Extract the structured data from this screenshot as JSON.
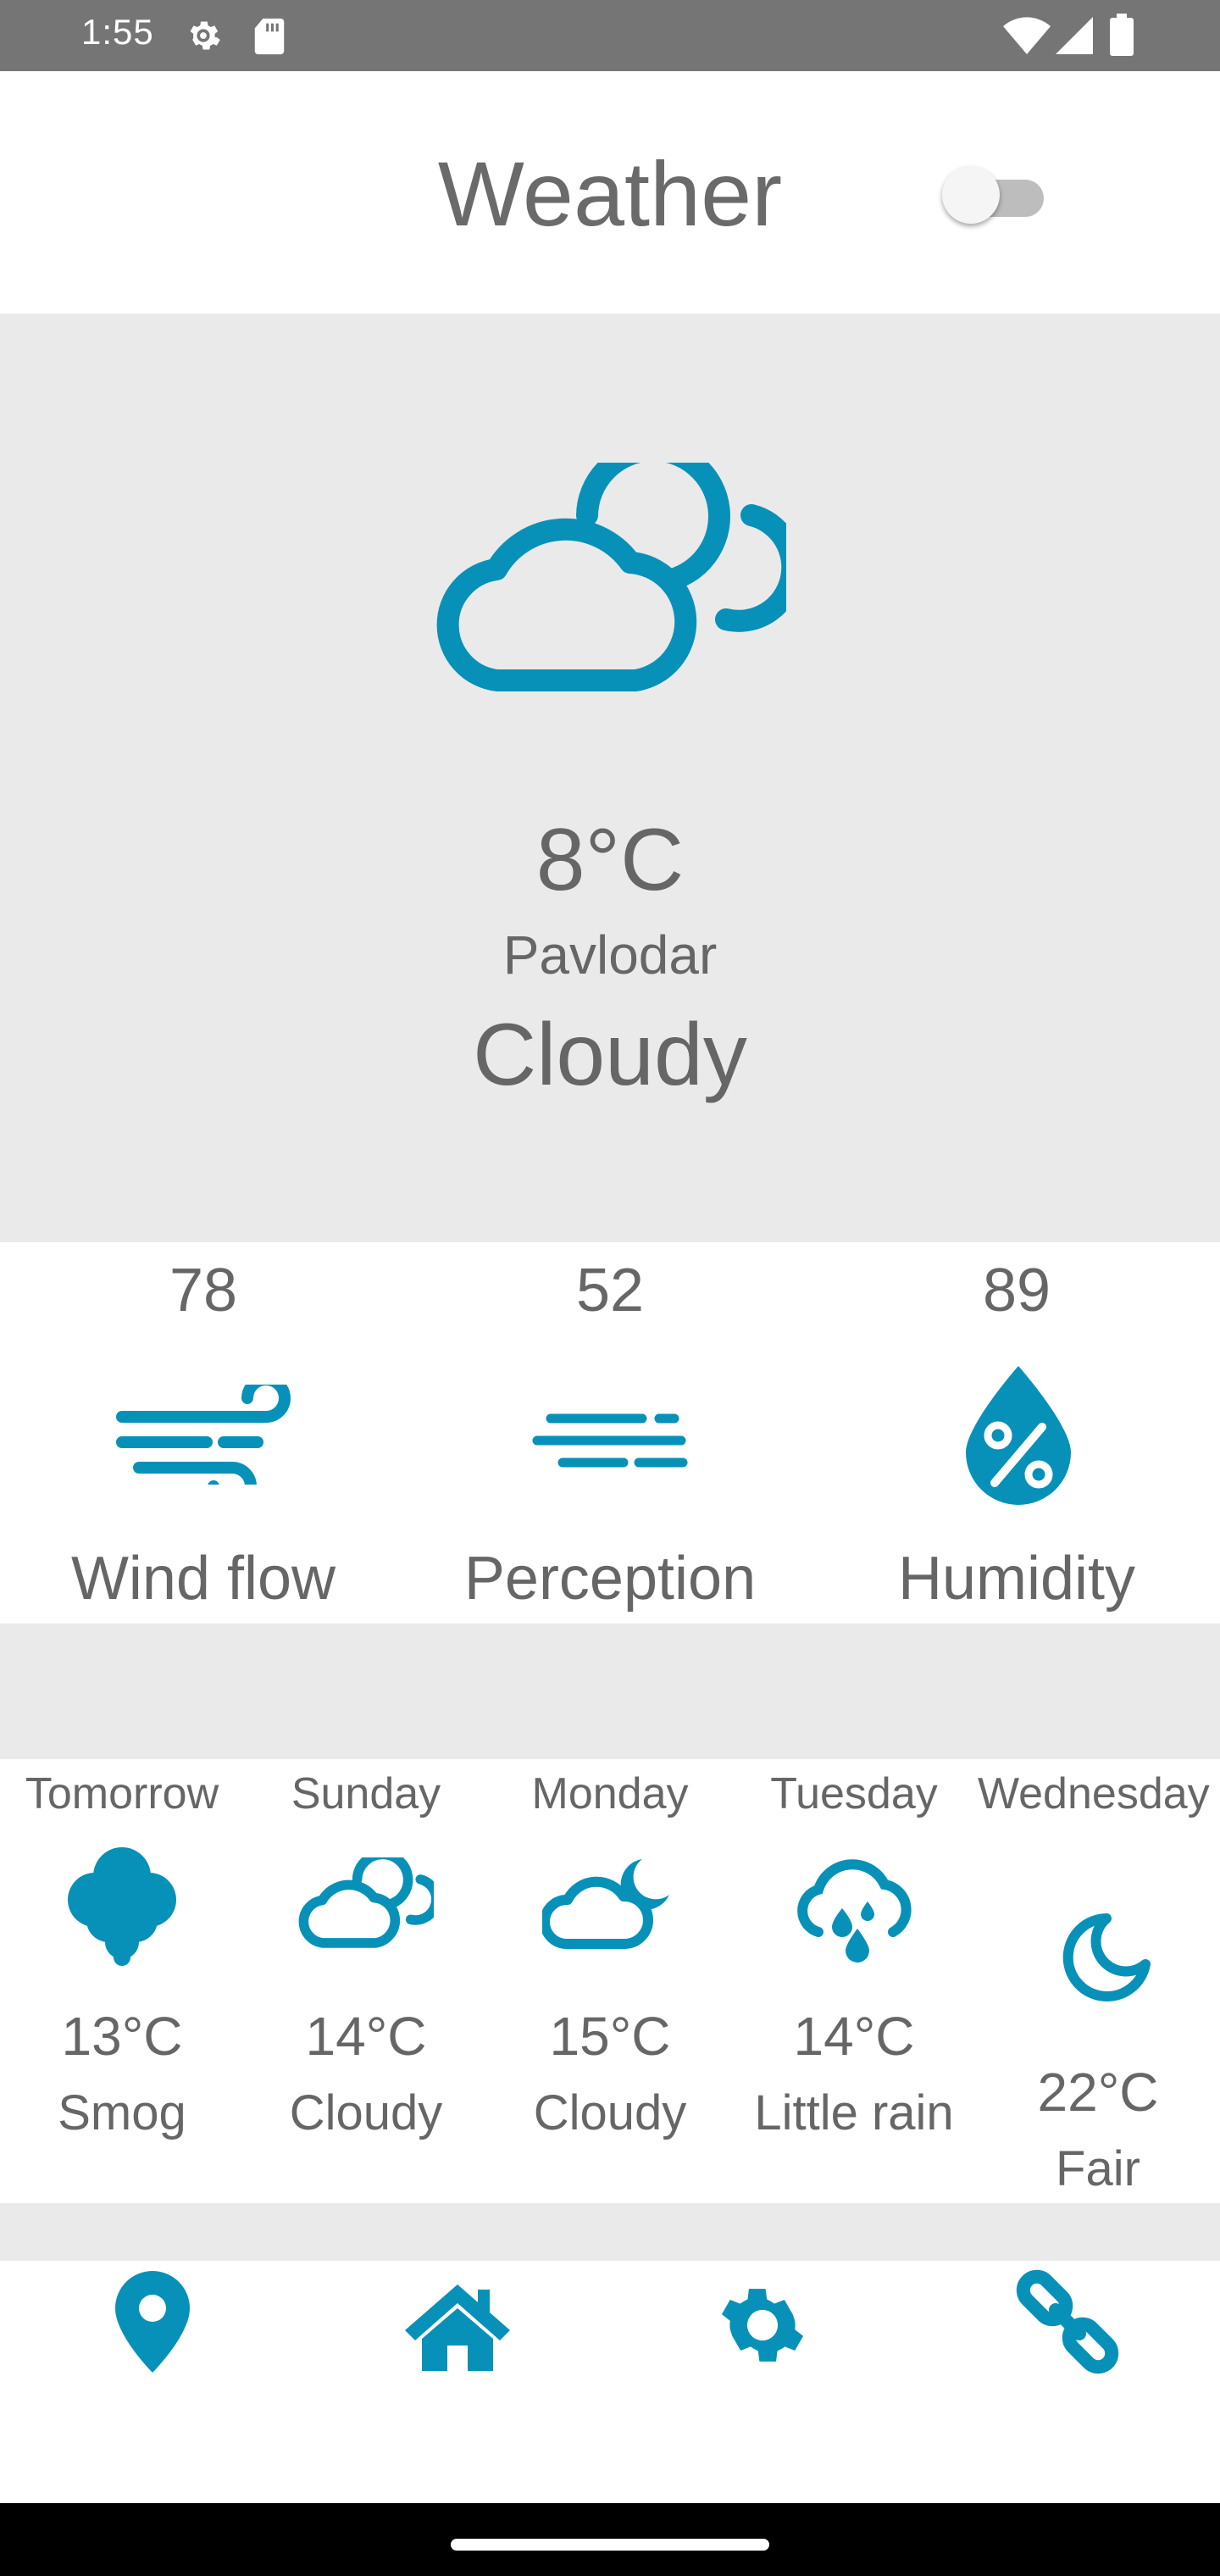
{
  "status_bar": {
    "time": "1:55",
    "icons": [
      "settings-gear-icon",
      "sd-card-icon",
      "wifi-icon",
      "cell-signal-icon",
      "battery-icon"
    ]
  },
  "header": {
    "title": "Weather",
    "toggle_on": false
  },
  "current": {
    "icon": "cloudy-icon",
    "temperature": "8°C",
    "city": "Pavlodar",
    "condition": "Cloudy"
  },
  "stats": [
    {
      "value": "78",
      "label": "Wind flow",
      "icon": "wind-icon"
    },
    {
      "value": "52",
      "label": "Perception",
      "icon": "fog-lines-icon"
    },
    {
      "value": "89",
      "label": "Humidity",
      "icon": "humidity-drop-icon"
    }
  ],
  "forecast": [
    {
      "day": "Tomorrow",
      "temperature": "13°C",
      "condition": "Smog",
      "icon": "smog-icon"
    },
    {
      "day": "Sunday",
      "temperature": "14°C",
      "condition": "Cloudy",
      "icon": "cloudy-icon"
    },
    {
      "day": "Monday",
      "temperature": "15°C",
      "condition": "Cloudy",
      "icon": "cloudy-night-icon"
    },
    {
      "day": "Tuesday",
      "temperature": "14°C",
      "condition": "Little rain",
      "icon": "rain-icon"
    },
    {
      "day": "Wednesday",
      "temperature": "22°C",
      "condition": "Fair",
      "icon": "moon-icon"
    }
  ],
  "bottom_nav": [
    "location-pin-icon",
    "home-icon",
    "settings-gear-icon",
    "link-icon"
  ],
  "colors": {
    "accent": "#0791b8",
    "text": "#666666",
    "panel": "#eaeaea",
    "status_bar": "#757575"
  }
}
